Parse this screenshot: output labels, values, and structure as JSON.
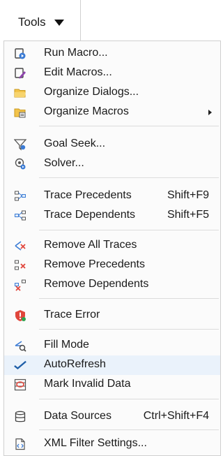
{
  "toolbar": {
    "tools_label": "Tools"
  },
  "menu": {
    "items": [
      {
        "label": "Run Macro...",
        "icon": "run-macro-icon"
      },
      {
        "label": "Edit Macros...",
        "icon": "edit-macros-icon"
      },
      {
        "label": "Organize Dialogs...",
        "icon": "folder-icon"
      },
      {
        "label": "Organize Macros",
        "icon": "folder-macros-icon",
        "submenu": true
      },
      {
        "label": "Goal Seek...",
        "icon": "goal-seek-icon"
      },
      {
        "label": "Solver...",
        "icon": "solver-icon"
      },
      {
        "label": "Trace Precedents",
        "shortcut": "Shift+F9",
        "icon": "trace-precedents-icon"
      },
      {
        "label": "Trace Dependents",
        "shortcut": "Shift+F5",
        "icon": "trace-dependents-icon"
      },
      {
        "label": "Remove All Traces",
        "icon": "remove-all-traces-icon"
      },
      {
        "label": "Remove Precedents",
        "icon": "remove-precedents-icon"
      },
      {
        "label": "Remove Dependents",
        "icon": "remove-dependents-icon"
      },
      {
        "label": "Trace Error",
        "icon": "trace-error-icon"
      },
      {
        "label": "Fill Mode",
        "icon": "fill-mode-icon"
      },
      {
        "label": "AutoRefresh",
        "icon": "checkmark-icon",
        "checked": true
      },
      {
        "label": "Mark Invalid Data",
        "icon": "mark-invalid-data-icon"
      },
      {
        "label": "Data Sources",
        "shortcut": "Ctrl+Shift+F4",
        "icon": "database-icon"
      },
      {
        "label": "XML Filter Settings...",
        "icon": "xml-filter-icon"
      }
    ]
  }
}
